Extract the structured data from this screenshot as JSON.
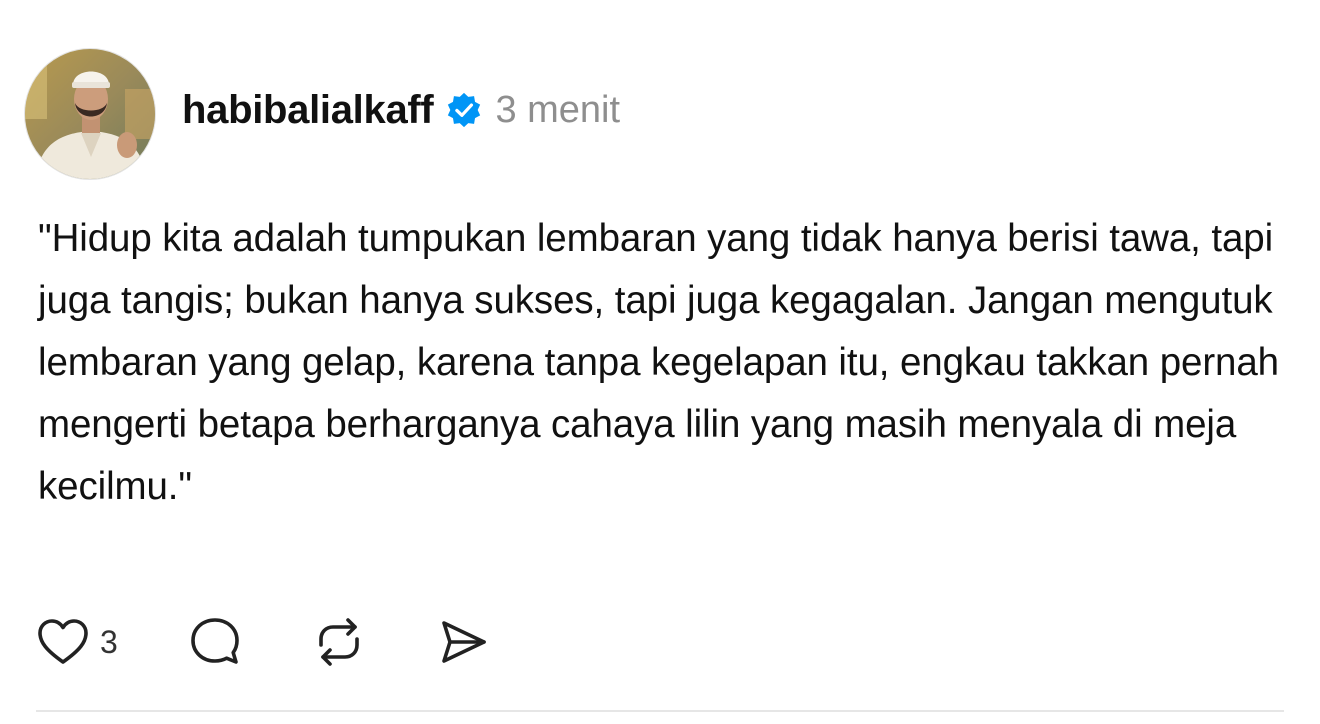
{
  "post": {
    "username": "habibalialkaff",
    "time_ago": "3 menit",
    "text": "\"Hidup kita adalah tumpukan lembaran yang tidak hanya berisi tawa, tapi juga tangis; bukan hanya sukses, tapi juga kegagalan. Jangan mengutuk lembaran yang gelap, karena tanpa kegelapan itu, engkau takkan pernah mengerti betapa berharganya cahaya lilin yang masih menyala di meja kecilmu.\"",
    "likes": "3"
  },
  "icons": {
    "verified": "verified-badge-icon",
    "like": "heart-icon",
    "comment": "comment-bubble-icon",
    "repost": "repost-icon",
    "share": "send-icon"
  },
  "colors": {
    "verified_blue": "#0095f6",
    "text": "#111111",
    "muted": "#8e8e8e",
    "icon": "#222222"
  }
}
